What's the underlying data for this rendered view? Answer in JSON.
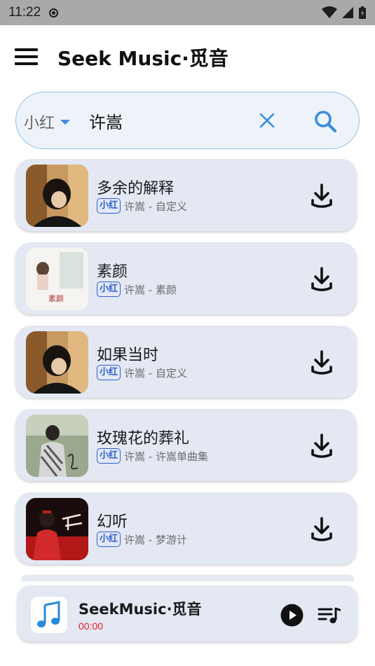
{
  "status_bar": {
    "time": "11:22"
  },
  "app_bar": {
    "title": "Seek Music·觅音"
  },
  "search": {
    "source": "小红",
    "query": "许嵩"
  },
  "songs": [
    {
      "title": "多余的解释",
      "badge": "小红",
      "meta": "许嵩 - 自定义",
      "cover": "cover-portrait-1"
    },
    {
      "title": "素颜",
      "badge": "小红",
      "meta": "许嵩 - 素颜",
      "cover": "cover-suyan"
    },
    {
      "title": "如果当时",
      "badge": "小红",
      "meta": "许嵩 - 自定义",
      "cover": "cover-portrait-1"
    },
    {
      "title": "玫瑰花的葬礼",
      "badge": "小红",
      "meta": "许嵩 - 许嵩单曲集",
      "cover": "cover-portrait-2"
    },
    {
      "title": "幻听",
      "badge": "小红",
      "meta": "许嵩 - 梦游计",
      "cover": "cover-mengyouji"
    }
  ],
  "player": {
    "title": "SeekMusic·觅音",
    "time": "00:00"
  },
  "colors": {
    "accent": "#3b8ddc",
    "badge": "#2f5fd0",
    "card": "#e3e8f3",
    "time_red": "#e02020"
  }
}
